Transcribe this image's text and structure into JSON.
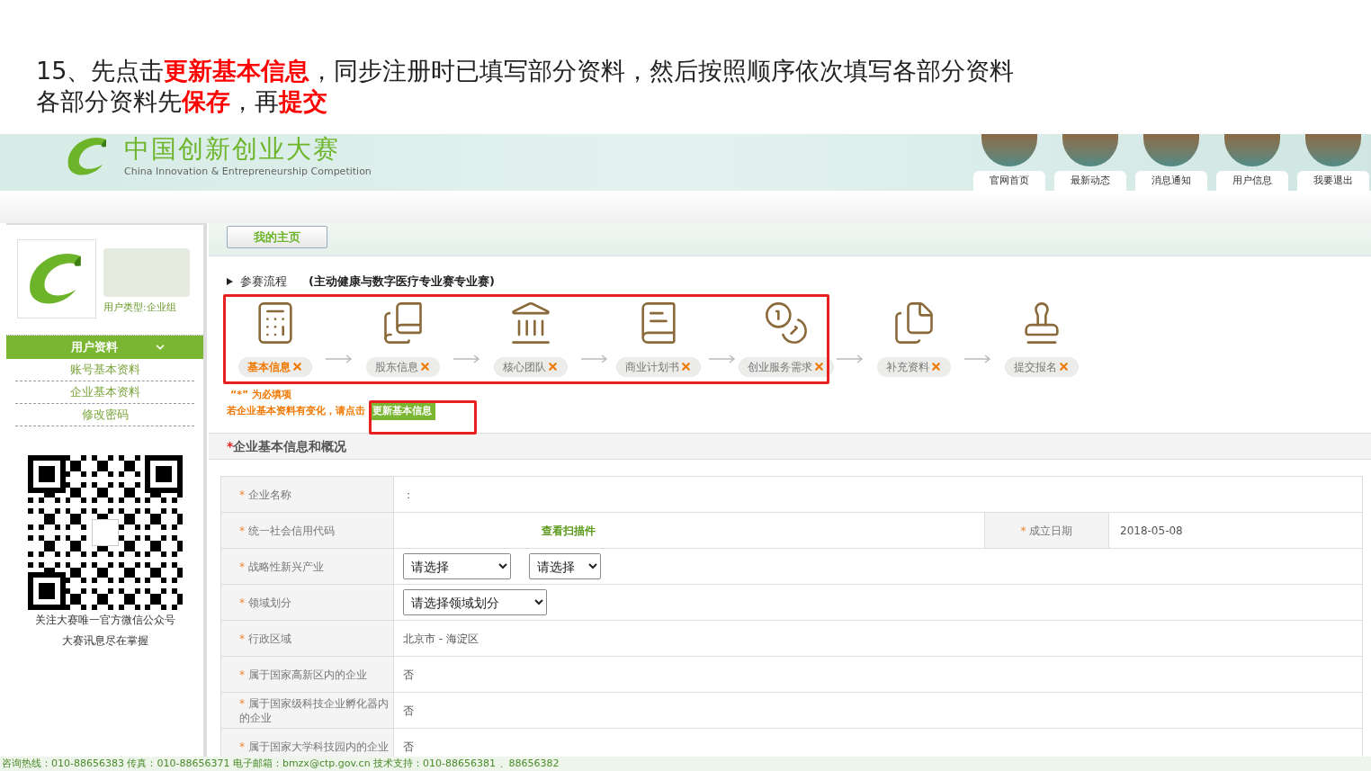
{
  "instruction": {
    "lines": [
      "15、先点击**更新基本信息**，同步注册时已填写部分资料，然后按照顺序依次填写各部分资料",
      "各部分资料先**保存**，再**提交**"
    ]
  },
  "site": {
    "title": "中国创新创业大赛",
    "subtitle": "China Innovation & Entrepreneurship Competition",
    "nav": [
      "官网首页",
      "最新动态",
      "消息通知",
      "用户信息",
      "我要退出"
    ]
  },
  "sidebar": {
    "user_type": "用户类型:企业组",
    "menu": {
      "title": "用户资料",
      "expanded": true,
      "items": [
        "账号基本资料",
        "企业基本资料",
        "修改密码"
      ]
    },
    "qr_caption": [
      "关注大赛唯一官方微信公众号",
      "大赛讯息尽在掌握"
    ]
  },
  "home_tab": "我的主页",
  "process": {
    "label": "参赛流程",
    "subtitle": "(主动健康与数字医疗专业赛专业赛)",
    "steps": [
      {
        "label": "基本信息",
        "selected": true,
        "completed": false
      },
      {
        "label": "股东信息",
        "selected": false,
        "completed": false
      },
      {
        "label": "核心团队",
        "selected": false,
        "completed": false
      },
      {
        "label": "商业计划书",
        "selected": false,
        "completed": false
      },
      {
        "label": "创业服务需求",
        "selected": false,
        "completed": false
      },
      {
        "label": "补充资料",
        "selected": false,
        "completed": false
      },
      {
        "label": "提交报名",
        "selected": false,
        "completed": false
      }
    ]
  },
  "notes": {
    "required_hint": "“*” 为必填项",
    "update_hint": "若企业基本资料有变化，请点击",
    "update_button": "更新基本信息"
  },
  "section_title": {
    "mark": "*",
    "text": "企业基本信息和概况"
  },
  "form_rows": [
    {
      "kind": "text",
      "mark": "*",
      "label": "企业名称",
      "value": "："
    },
    {
      "kind": "link_pair",
      "mark": "*",
      "label": "统一社会信用代码",
      "link": "查看扫描件",
      "extra_mark": "*",
      "extra_label": "成立日期",
      "extra_value": "2018-05-08"
    },
    {
      "kind": "select",
      "mark": "*",
      "label": "战略性新兴产业",
      "options": [
        "请选择",
        "请选择"
      ]
    },
    {
      "kind": "select",
      "mark": "*",
      "label": "领域划分",
      "options": [
        "请选择领域划分"
      ]
    },
    {
      "kind": "text",
      "mark": "*",
      "label": "行政区域",
      "value": "北京市 - 海淀区"
    },
    {
      "kind": "text",
      "mark": "*",
      "label": "属于国家高新区内的企业",
      "value": "否"
    },
    {
      "kind": "text",
      "mark": "*",
      "label": "属于国家级科技企业孵化器内的企业",
      "value": "否"
    },
    {
      "kind": "text",
      "mark": "*",
      "label": "属于国家大学科技园内的企业",
      "value": "否"
    }
  ],
  "footer": "咨询热线：010-88656383 传真：010-88656371 电子邮箱：bmzx@ctp.gov.cn 技术支持：010-88656381 、88656382"
}
